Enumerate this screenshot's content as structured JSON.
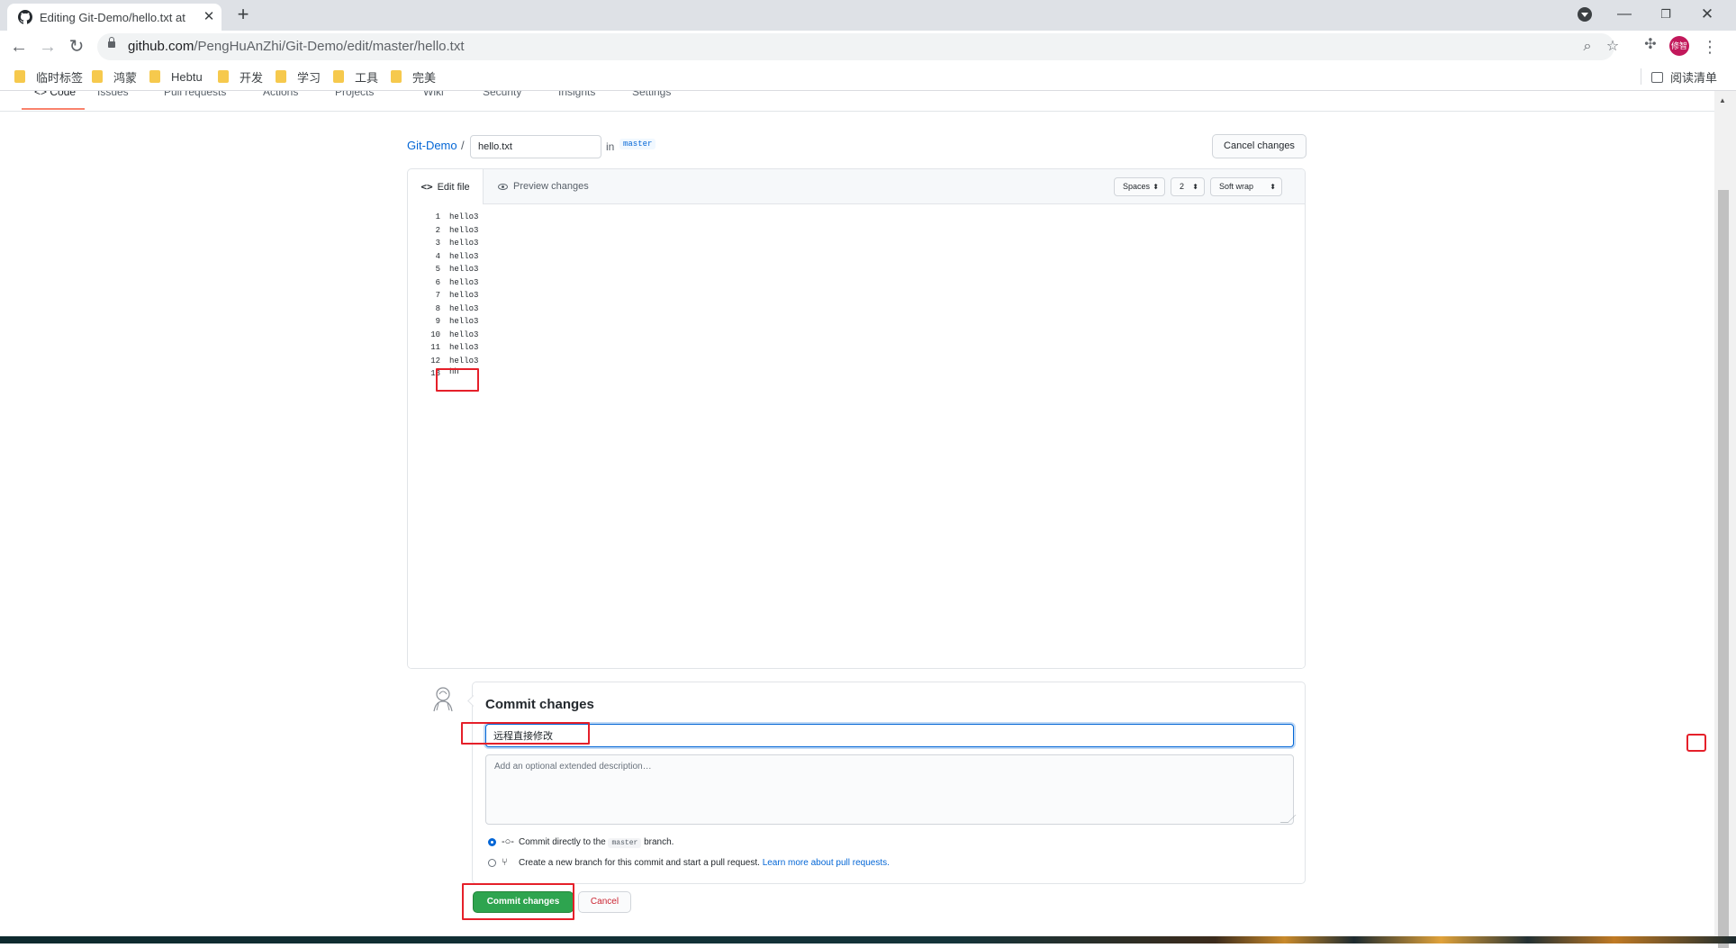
{
  "browser": {
    "tab_title": "Editing Git-Demo/hello.txt at",
    "url_host": "github.com",
    "url_path": "/PengHuAnZhi/Git-Demo/edit/master/hello.txt",
    "avatar_text": "修智",
    "bookmarks": [
      "临时标签",
      "鸿蒙",
      "Hebtu",
      "开发",
      "学习",
      "工具",
      "完美"
    ],
    "reading_list": "阅读清单"
  },
  "repo_nav": {
    "items": [
      "<> Code",
      "Issues",
      "Pull requests",
      "Actions",
      "Projects",
      "Wiki",
      "Security",
      "Insights",
      "Settings"
    ]
  },
  "breadcrumb": {
    "repo": "Git-Demo",
    "separator": "/",
    "filename": "hello.txt",
    "in_label": "in",
    "branch": "master",
    "cancel_changes": "Cancel changes"
  },
  "editor": {
    "tab_edit": "Edit file",
    "tab_preview": "Preview changes",
    "indent_mode": "Spaces",
    "indent_size": "2",
    "wrap_mode": "Soft wrap",
    "lines": [
      {
        "n": "1",
        "text": "hello3"
      },
      {
        "n": "2",
        "text": "hello3"
      },
      {
        "n": "3",
        "text": "hello3"
      },
      {
        "n": "4",
        "text": "hello3"
      },
      {
        "n": "5",
        "text": "hello3"
      },
      {
        "n": "6",
        "text": "hello3"
      },
      {
        "n": "7",
        "text": "hello3"
      },
      {
        "n": "8",
        "text": "hello3"
      },
      {
        "n": "9",
        "text": "hello3"
      },
      {
        "n": "10",
        "text": "hello3"
      },
      {
        "n": "11",
        "text": "hello3"
      },
      {
        "n": "12",
        "text": "hello3"
      },
      {
        "n": "13",
        "text": "hh"
      }
    ]
  },
  "commit": {
    "title": "Commit changes",
    "summary_value": "远程直接修改",
    "description_placeholder": "Add an optional extended description…",
    "option_direct_prefix": "Commit directly to the",
    "option_direct_branch": "master",
    "option_direct_suffix": "branch.",
    "option_newbranch": "Create a new branch for this commit and start a pull request.",
    "option_newbranch_link": "Learn more about pull requests.",
    "commit_button": "Commit changes",
    "cancel_button": "Cancel"
  },
  "colors": {
    "primary_button": "#2ea44f",
    "link": "#0366d6",
    "annotation": "#e5202a"
  }
}
